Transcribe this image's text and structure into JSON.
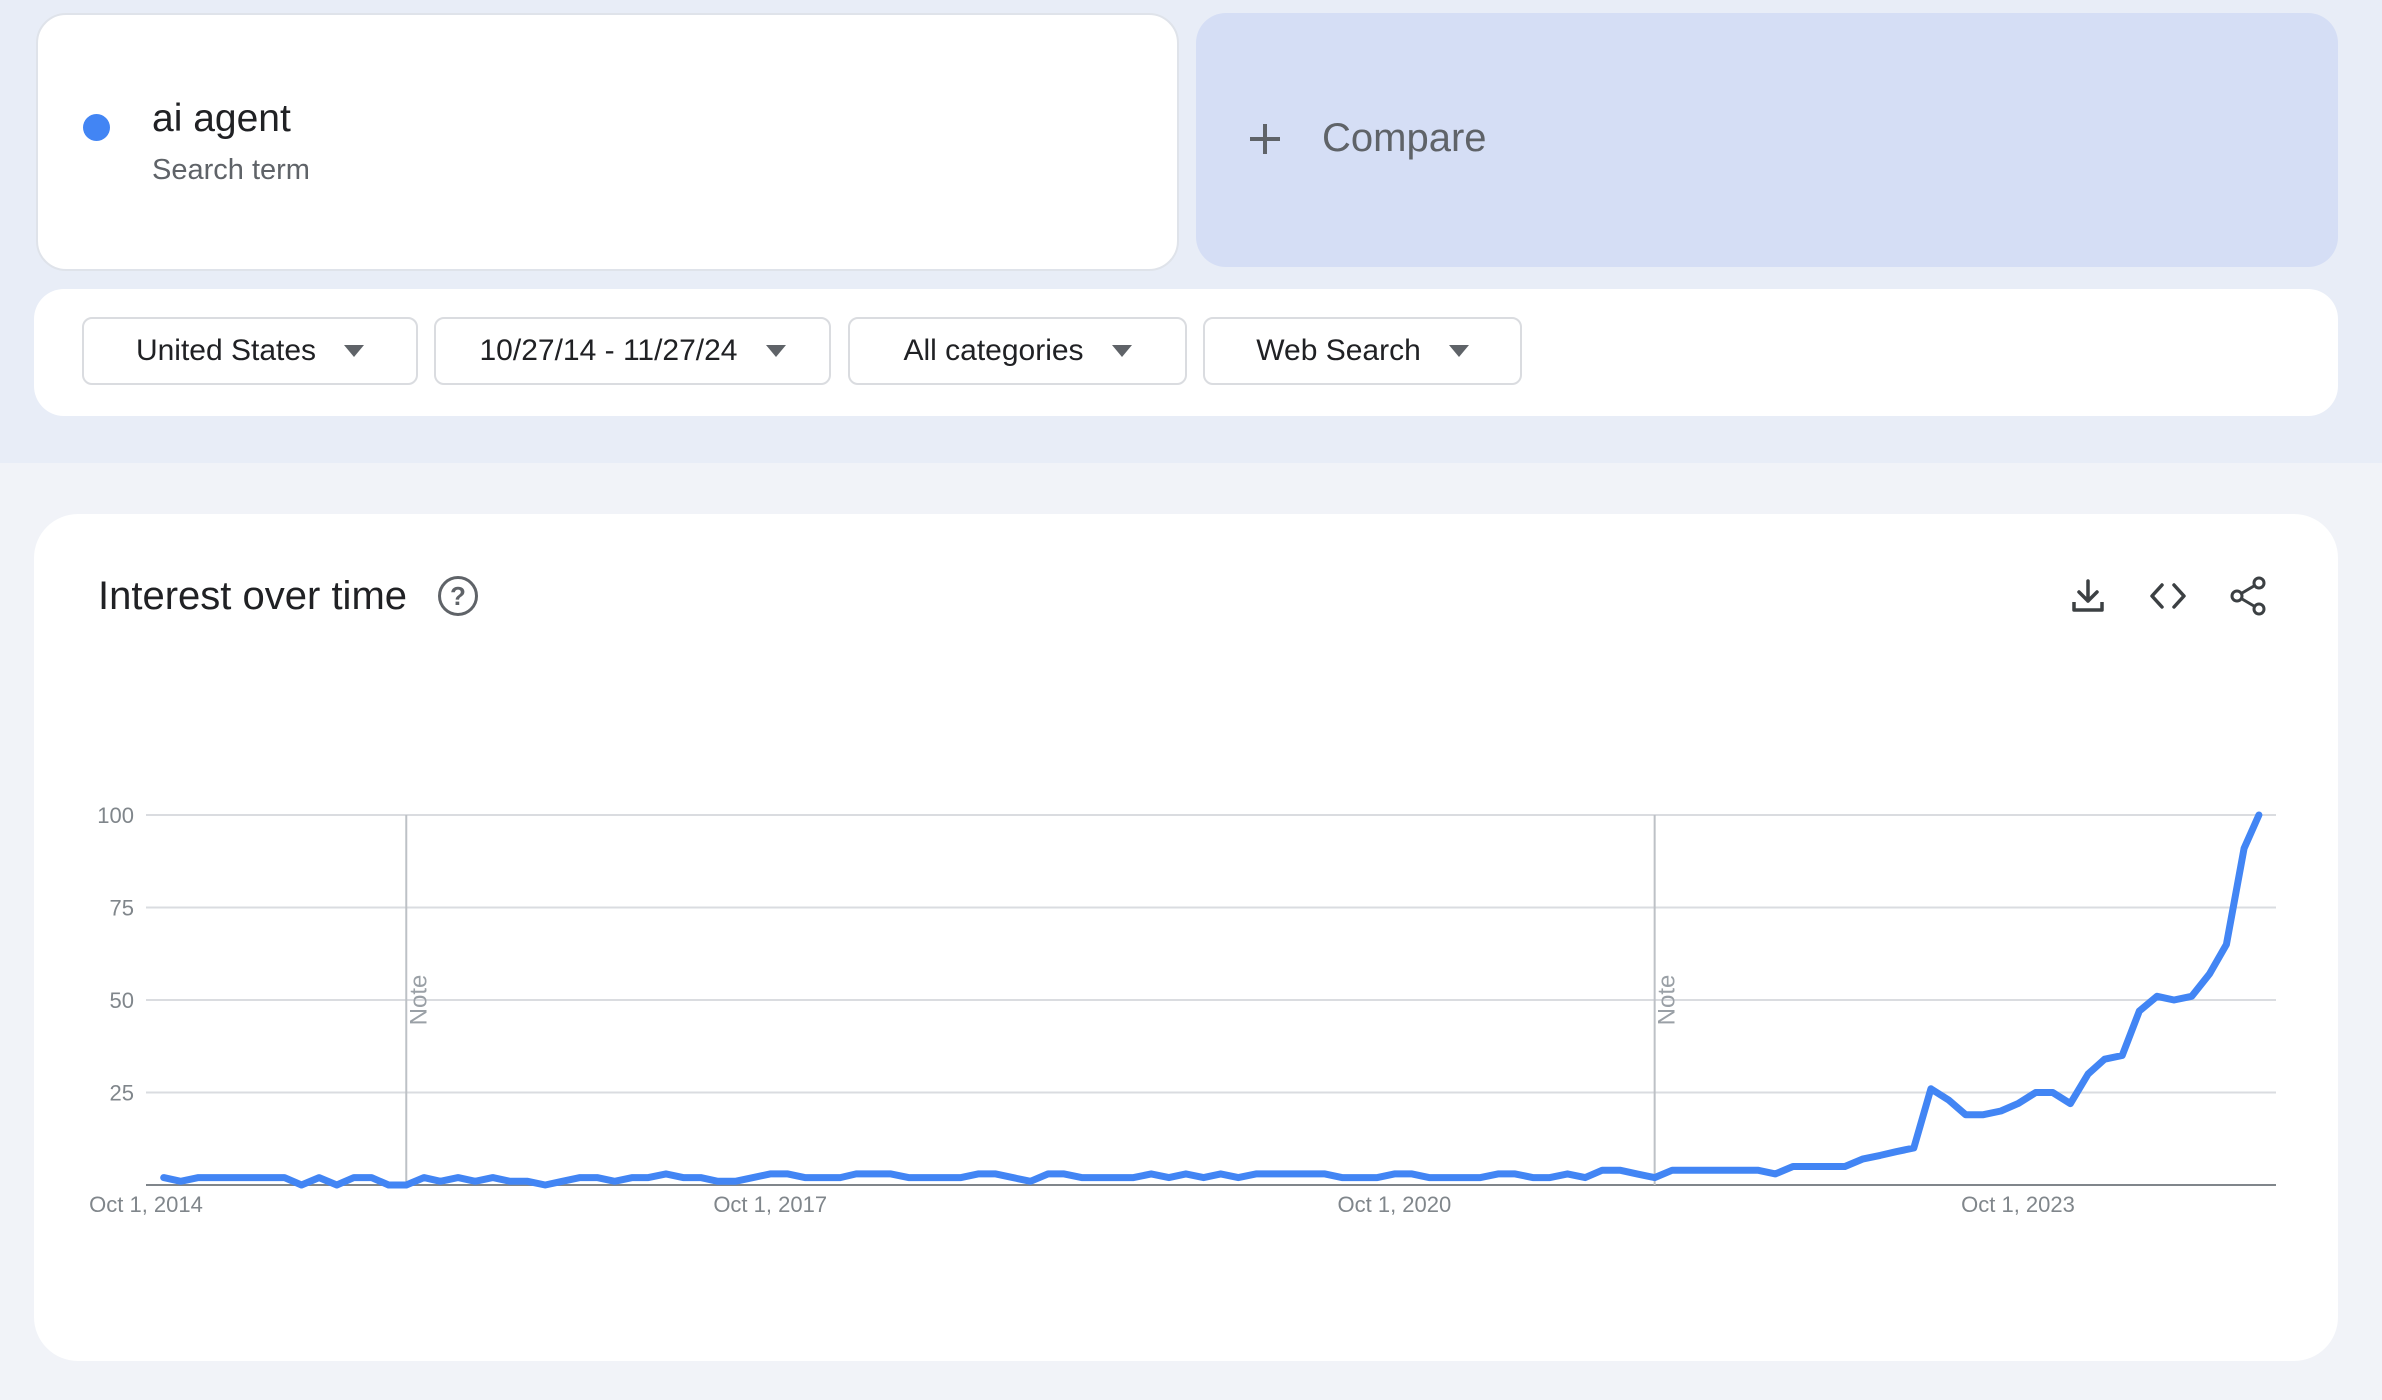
{
  "term": {
    "name": "ai agent",
    "type": "Search term",
    "color": "#4285f4"
  },
  "compare": {
    "label": "Compare",
    "icon": "plus-icon"
  },
  "filters": [
    {
      "label": "United States",
      "icon": "caret-down-icon"
    },
    {
      "label": "10/27/14 - 11/27/24",
      "icon": "caret-down-icon"
    },
    {
      "label": "All categories",
      "icon": "caret-down-icon"
    },
    {
      "label": "Web Search",
      "icon": "caret-down-icon"
    }
  ],
  "panel": {
    "title": "Interest over time",
    "help_icon": "help-icon",
    "help_glyph": "?",
    "tools": [
      "download-icon",
      "embed-code-icon",
      "share-icon"
    ]
  },
  "chart_data": {
    "type": "line",
    "title": "Interest over time",
    "xlabel": "",
    "ylabel": "",
    "ylim": [
      0,
      100
    ],
    "yticks": [
      25,
      50,
      75,
      100
    ],
    "xlim": [
      "2014-10-27",
      "2024-11-27"
    ],
    "xticks": [
      {
        "date": "2014-10-01",
        "label": "Oct 1, 2014"
      },
      {
        "date": "2017-10-01",
        "label": "Oct 1, 2017"
      },
      {
        "date": "2020-10-01",
        "label": "Oct 1, 2020"
      },
      {
        "date": "2023-10-01",
        "label": "Oct 1, 2023"
      }
    ],
    "notes": [
      {
        "date": "2016-01-01",
        "label": "Note"
      },
      {
        "date": "2022-01-01",
        "label": "Note"
      }
    ],
    "grid": true,
    "legend": "none",
    "color": "#4285f4",
    "series": [
      {
        "name": "ai agent",
        "points": [
          [
            "2014-11-01",
            2
          ],
          [
            "2014-12-01",
            1
          ],
          [
            "2015-01-01",
            2
          ],
          [
            "2015-02-01",
            2
          ],
          [
            "2015-03-01",
            2
          ],
          [
            "2015-04-01",
            2
          ],
          [
            "2015-05-01",
            2
          ],
          [
            "2015-06-01",
            2
          ],
          [
            "2015-07-01",
            0
          ],
          [
            "2015-08-01",
            2
          ],
          [
            "2015-09-01",
            0
          ],
          [
            "2015-10-01",
            2
          ],
          [
            "2015-11-01",
            2
          ],
          [
            "2015-12-01",
            0
          ],
          [
            "2016-01-01",
            0
          ],
          [
            "2016-02-01",
            2
          ],
          [
            "2016-03-01",
            1
          ],
          [
            "2016-04-01",
            2
          ],
          [
            "2016-05-01",
            1
          ],
          [
            "2016-06-01",
            2
          ],
          [
            "2016-07-01",
            1
          ],
          [
            "2016-08-01",
            1
          ],
          [
            "2016-09-01",
            0
          ],
          [
            "2016-10-01",
            1
          ],
          [
            "2016-11-01",
            2
          ],
          [
            "2016-12-01",
            2
          ],
          [
            "2017-01-01",
            1
          ],
          [
            "2017-02-01",
            2
          ],
          [
            "2017-03-01",
            2
          ],
          [
            "2017-04-01",
            3
          ],
          [
            "2017-05-01",
            2
          ],
          [
            "2017-06-01",
            2
          ],
          [
            "2017-07-01",
            1
          ],
          [
            "2017-08-01",
            1
          ],
          [
            "2017-09-01",
            2
          ],
          [
            "2017-10-01",
            3
          ],
          [
            "2017-11-01",
            3
          ],
          [
            "2017-12-01",
            2
          ],
          [
            "2018-01-01",
            2
          ],
          [
            "2018-02-01",
            2
          ],
          [
            "2018-03-01",
            3
          ],
          [
            "2018-04-01",
            3
          ],
          [
            "2018-05-01",
            3
          ],
          [
            "2018-06-01",
            2
          ],
          [
            "2018-07-01",
            2
          ],
          [
            "2018-08-01",
            2
          ],
          [
            "2018-09-01",
            2
          ],
          [
            "2018-10-01",
            3
          ],
          [
            "2018-11-01",
            3
          ],
          [
            "2018-12-01",
            2
          ],
          [
            "2019-01-01",
            1
          ],
          [
            "2019-02-01",
            3
          ],
          [
            "2019-03-01",
            3
          ],
          [
            "2019-04-01",
            2
          ],
          [
            "2019-05-01",
            2
          ],
          [
            "2019-06-01",
            2
          ],
          [
            "2019-07-01",
            2
          ],
          [
            "2019-08-01",
            3
          ],
          [
            "2019-09-01",
            2
          ],
          [
            "2019-10-01",
            3
          ],
          [
            "2019-11-01",
            2
          ],
          [
            "2019-12-01",
            3
          ],
          [
            "2020-01-01",
            2
          ],
          [
            "2020-02-01",
            3
          ],
          [
            "2020-03-01",
            3
          ],
          [
            "2020-04-01",
            3
          ],
          [
            "2020-05-01",
            3
          ],
          [
            "2020-06-01",
            3
          ],
          [
            "2020-07-01",
            2
          ],
          [
            "2020-08-01",
            2
          ],
          [
            "2020-09-01",
            2
          ],
          [
            "2020-10-01",
            3
          ],
          [
            "2020-11-01",
            3
          ],
          [
            "2020-12-01",
            2
          ],
          [
            "2021-01-01",
            2
          ],
          [
            "2021-02-01",
            2
          ],
          [
            "2021-03-01",
            2
          ],
          [
            "2021-04-01",
            3
          ],
          [
            "2021-05-01",
            3
          ],
          [
            "2021-06-01",
            2
          ],
          [
            "2021-07-01",
            2
          ],
          [
            "2021-08-01",
            3
          ],
          [
            "2021-09-01",
            2
          ],
          [
            "2021-10-01",
            4
          ],
          [
            "2021-11-01",
            4
          ],
          [
            "2021-12-01",
            3
          ],
          [
            "2022-01-01",
            2
          ],
          [
            "2022-02-01",
            4
          ],
          [
            "2022-03-01",
            4
          ],
          [
            "2022-04-01",
            4
          ],
          [
            "2022-05-01",
            4
          ],
          [
            "2022-06-01",
            4
          ],
          [
            "2022-07-01",
            4
          ],
          [
            "2022-08-01",
            3
          ],
          [
            "2022-09-01",
            5
          ],
          [
            "2022-10-01",
            5
          ],
          [
            "2022-11-01",
            5
          ],
          [
            "2022-12-01",
            5
          ],
          [
            "2023-01-01",
            7
          ],
          [
            "2023-02-01",
            8
          ],
          [
            "2023-03-01",
            9
          ],
          [
            "2023-04-01",
            10
          ],
          [
            "2023-05-01",
            26
          ],
          [
            "2023-06-01",
            23
          ],
          [
            "2023-07-01",
            19
          ],
          [
            "2023-08-01",
            19
          ],
          [
            "2023-09-01",
            20
          ],
          [
            "2023-10-01",
            22
          ],
          [
            "2023-11-01",
            25
          ],
          [
            "2023-12-01",
            25
          ],
          [
            "2024-01-01",
            22
          ],
          [
            "2024-02-01",
            30
          ],
          [
            "2024-03-01",
            34
          ],
          [
            "2024-04-01",
            35
          ],
          [
            "2024-05-01",
            47
          ],
          [
            "2024-06-01",
            51
          ],
          [
            "2024-07-01",
            50
          ],
          [
            "2024-08-01",
            51
          ],
          [
            "2024-09-01",
            57
          ],
          [
            "2024-10-01",
            65
          ],
          [
            "2024-11-01",
            91
          ],
          [
            "2024-11-27",
            100
          ]
        ]
      }
    ]
  }
}
